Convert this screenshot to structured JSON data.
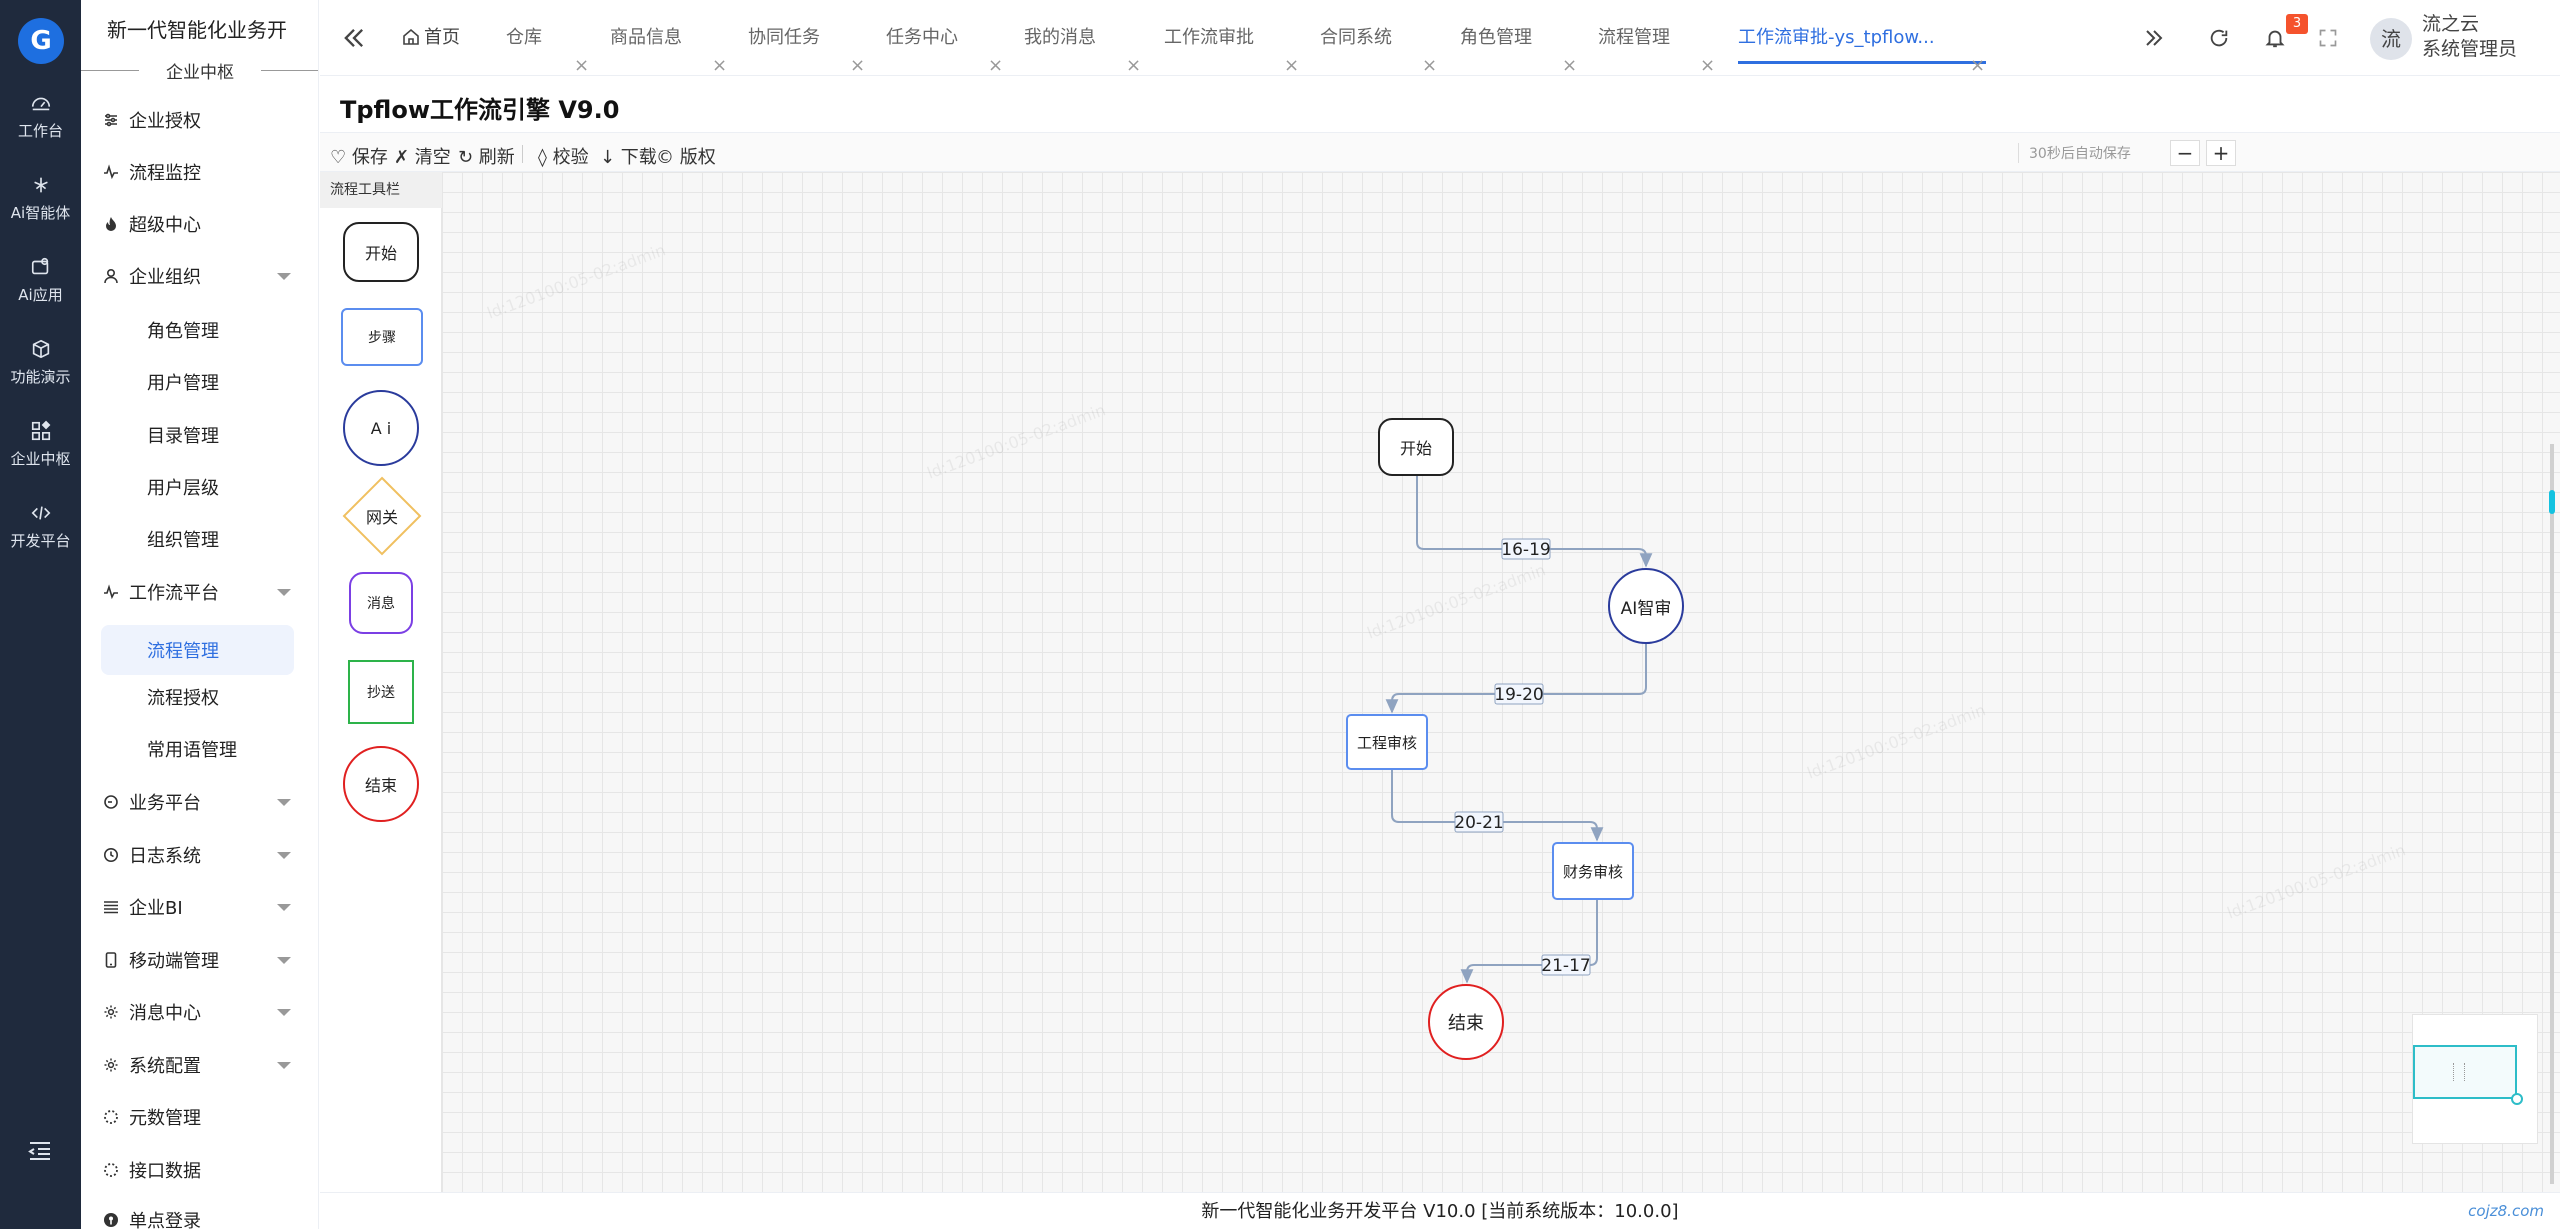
{
  "rail": {
    "logo": "G",
    "items": [
      "工作台",
      "Ai智能体",
      "Ai应用",
      "功能演示",
      "企业中枢",
      "开发平台"
    ]
  },
  "sidebar": {
    "brand": "新一代智能化业务开",
    "section": "企业中枢",
    "items": [
      {
        "label": "企业授权",
        "icon": "sliders-icon",
        "caret": false
      },
      {
        "label": "流程监控",
        "icon": "pulse-icon",
        "caret": false
      },
      {
        "label": "超级中心",
        "icon": "flame-icon",
        "caret": false
      },
      {
        "label": "企业组织",
        "icon": "user-icon",
        "caret": true
      },
      {
        "label": "角色管理",
        "sub": true
      },
      {
        "label": "用户管理",
        "sub": true
      },
      {
        "label": "目录管理",
        "sub": true
      },
      {
        "label": "用户层级",
        "sub": true
      },
      {
        "label": "组织管理",
        "sub": true
      },
      {
        "label": "工作流平台",
        "icon": "pulse-icon",
        "caret": true
      },
      {
        "label": "流程管理",
        "sub": true,
        "active": true
      },
      {
        "label": "流程授权",
        "sub": true
      },
      {
        "label": "常用语管理",
        "sub": true
      },
      {
        "label": "业务平台",
        "icon": "circle-icon",
        "caret": true
      },
      {
        "label": "日志系统",
        "icon": "clock-icon",
        "caret": true
      },
      {
        "label": "企业BI",
        "icon": "list-icon",
        "caret": true
      },
      {
        "label": "移动端管理",
        "icon": "phone-icon",
        "caret": true
      },
      {
        "label": "消息中心",
        "icon": "gear-icon",
        "caret": true
      },
      {
        "label": "系统配置",
        "icon": "gear-icon",
        "caret": true
      },
      {
        "label": "元数管理",
        "icon": "dots-circle-icon",
        "caret": false
      },
      {
        "label": "接口数据",
        "icon": "dots-circle-icon",
        "caret": false
      },
      {
        "label": "单点登录",
        "icon": "key-icon",
        "caret": false
      }
    ]
  },
  "tabs": [
    {
      "label": "首页",
      "home": true
    },
    {
      "label": "仓库"
    },
    {
      "label": "商品信息"
    },
    {
      "label": "协同任务"
    },
    {
      "label": "任务中心"
    },
    {
      "label": "我的消息"
    },
    {
      "label": "工作流审批"
    },
    {
      "label": "合同系统"
    },
    {
      "label": "角色管理"
    },
    {
      "label": "流程管理"
    },
    {
      "label": "工作流审批-ys_tpflow...",
      "active": true
    }
  ],
  "header": {
    "notifications": "3",
    "avatar": "流",
    "user_line1": "流之云",
    "user_line2": "系统管理员"
  },
  "page": {
    "title": "Tpflow工作流引擎 V9.0"
  },
  "toolbar": {
    "save": "♡ 保存",
    "clear": "✗ 清空",
    "refresh": "↻ 刷新",
    "check": "◊ 校验",
    "download": "↓ 下载",
    "copyright": "© 版权",
    "autosave": "30秒后自动保存",
    "zoom_out": "−",
    "zoom_in": "+"
  },
  "palette": {
    "header": "流程工具栏",
    "items": [
      "开始",
      "步骤",
      "A i",
      "网关",
      "消息",
      "抄送",
      "结束"
    ]
  },
  "flow": {
    "nodes": {
      "start": "开始",
      "ai": "AI智审",
      "engineering": "工程审核",
      "finance": "财务审核",
      "end": "结束"
    },
    "edges": [
      "16-19",
      "19-20",
      "20-21",
      "21-17"
    ]
  },
  "colors": {
    "accent": "#2f6fe0",
    "rail_bg": "#1f2a3d",
    "edge": "#8fa3c0",
    "end_red": "#e02020",
    "ai_navy": "#2a3b9c"
  },
  "footer": {
    "text": "新一代智能化业务开发平台 V10.0 [当前系统版本：10.0.0]",
    "right": "cojz8.com"
  }
}
